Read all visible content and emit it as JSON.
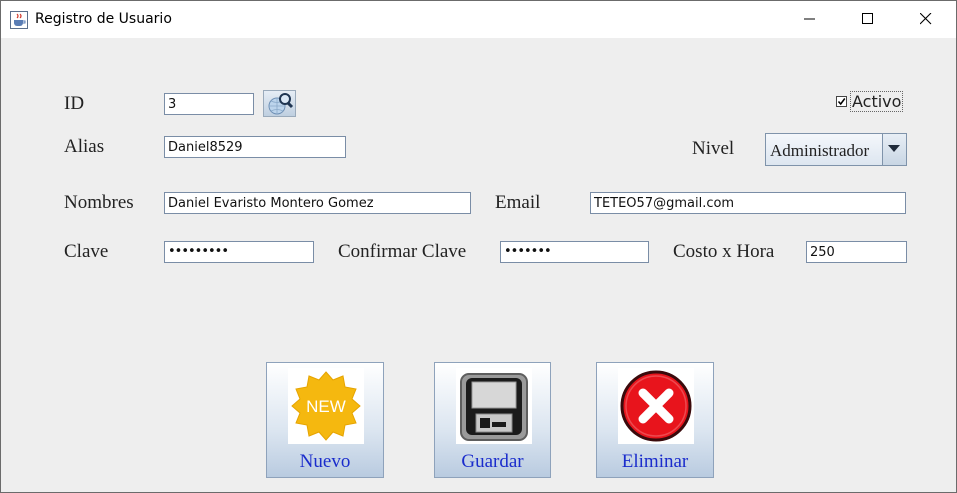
{
  "window": {
    "title": "Registro de Usuario"
  },
  "form": {
    "id_label": "ID",
    "id_value": "3",
    "alias_label": "Alias",
    "alias_value": "Daniel8529",
    "nombres_label": "Nombres",
    "nombres_value": "Daniel Evaristo Montero Gomez",
    "email_label": "Email",
    "email_value": "TETEO57@gmail.com",
    "clave_label": "Clave",
    "clave_value": "•••••••••",
    "confirmar_label": "Confirmar Clave",
    "confirmar_value": "•••••••",
    "costo_label": "Costo x Hora",
    "costo_value": "250",
    "nivel_label": "Nivel",
    "nivel_value": "Administrador",
    "activo_label": "Activo",
    "activo_checked": true
  },
  "buttons": {
    "nuevo": "Nuevo",
    "nuevo_badge": "NEW",
    "guardar": "Guardar",
    "eliminar": "Eliminar"
  },
  "icons": {
    "app": "java-cup-icon",
    "search": "search-globe-icon",
    "new": "new-badge-icon",
    "save": "floppy-disk-icon",
    "delete": "red-x-icon"
  },
  "colors": {
    "background": "#eeeeee",
    "button_text": "#1a2ccc",
    "new_badge": "#f5b80f",
    "delete": "#e8141c"
  }
}
